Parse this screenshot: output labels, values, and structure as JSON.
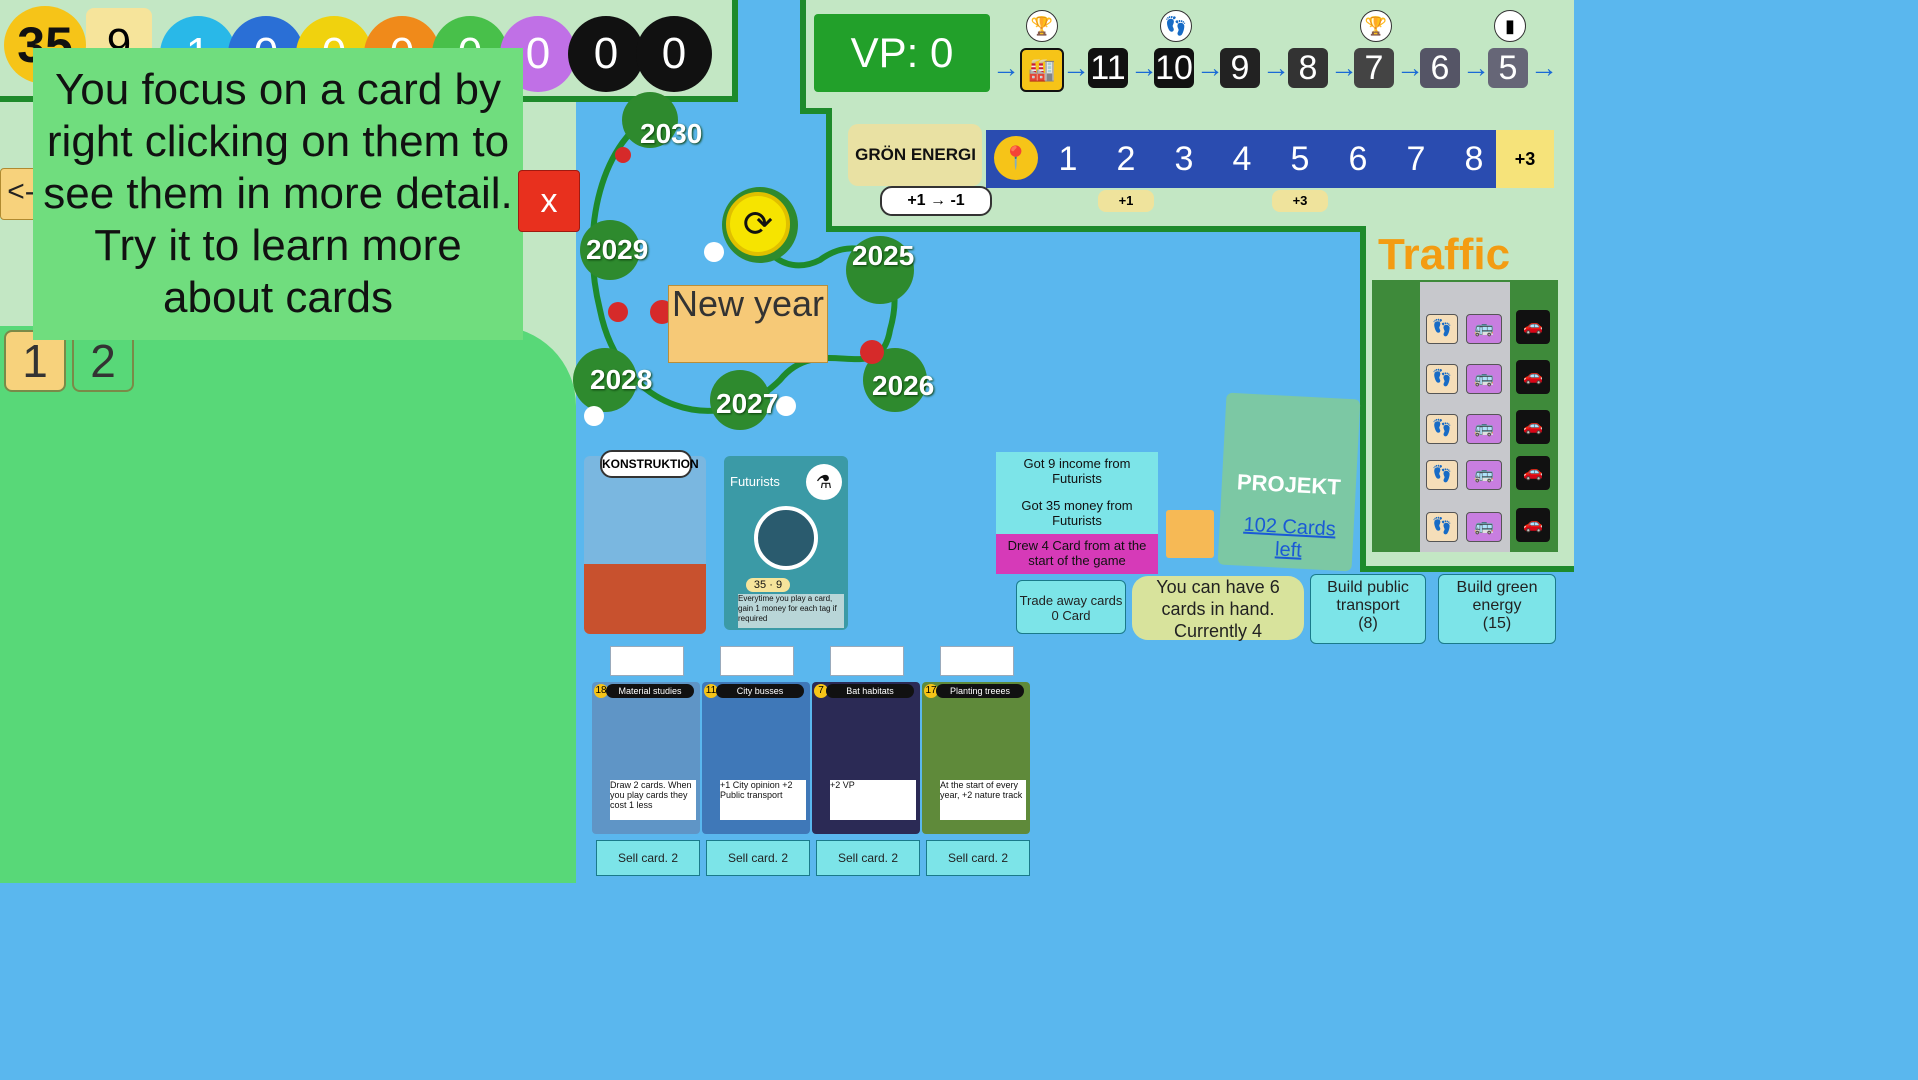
{
  "resources": {
    "money": "35",
    "income": "9",
    "counts": [
      "1",
      "0",
      "0",
      "0",
      "0",
      "0",
      "0",
      "0"
    ],
    "colors": [
      "#29b8e8",
      "#2a6fd6",
      "#f0d20e",
      "#f08a1a",
      "#48c04a",
      "#c070e6",
      "#111111",
      "#111111"
    ]
  },
  "tooltip": {
    "text": "You focus on a card by right clicking on them to see them in more detail. Try it to learn more about cards",
    "close_label": "x"
  },
  "nav": {
    "back_label": "<--"
  },
  "pages": [
    "1",
    "2"
  ],
  "timeline": {
    "years": [
      "2030",
      "2029",
      "2025",
      "2028",
      "2026",
      "2027"
    ],
    "new_year_label": "New year"
  },
  "vp": {
    "label": "VP: 0",
    "steps": [
      "11",
      "10",
      "9",
      "8",
      "7",
      "6",
      "5"
    ]
  },
  "energy": {
    "title": "GRÖN ENERGI",
    "track": [
      "1",
      "2",
      "3",
      "4",
      "5",
      "6",
      "7",
      "8"
    ],
    "end_reward": "+3",
    "bonus_1": "+1",
    "bonus_2": "+3",
    "conversion": "+1 → -1"
  },
  "traffic": {
    "title": "Traffic"
  },
  "cards": {
    "konstruktion_label": "KONSTRUKTION",
    "futurists": {
      "title": "Futurists",
      "cost": "35",
      "tag": "9",
      "text": "Everytime you play a card, gain 1 money for each tag if required"
    }
  },
  "log": {
    "line1": "Got 9 income from Futurists",
    "line2": "Got 35 money from Futurists",
    "line3": "Drew 4 Card from at the start of the game"
  },
  "deck": {
    "title": "PROJEKT",
    "cards_left": "102 Cards left"
  },
  "actions": {
    "trade_label": "Trade away cards",
    "trade_sub": "0 Card",
    "hand_info": "You can have 6 cards in hand. Currently 4",
    "build_transport": "Build public transport",
    "build_transport_cost": "(8)",
    "build_energy": "Build green energy",
    "build_energy_cost": "(15)"
  },
  "hand": [
    {
      "title": "Material studies",
      "cost": "18",
      "text": "Draw 2 cards. When you play cards they cost 1 less",
      "sell": "Sell card. 2"
    },
    {
      "title": "City busses",
      "cost": "11",
      "text": "+1 City opinion +2 Public transport",
      "sell": "Sell card. 2"
    },
    {
      "title": "Bat habitats",
      "cost": "7",
      "text": "+2 VP",
      "sell": "Sell card. 2"
    },
    {
      "title": "Planting treees",
      "cost": "17",
      "text": "At the start of every year, +2 nature track",
      "sell": "Sell card. 2"
    }
  ]
}
